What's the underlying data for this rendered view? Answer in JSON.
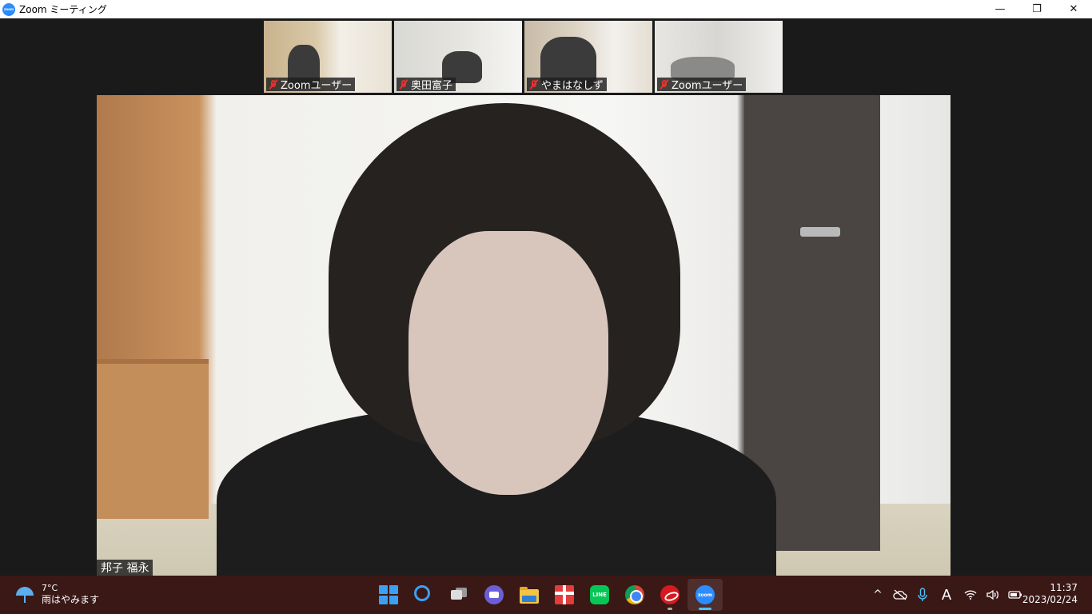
{
  "window": {
    "logo_text": "zoom",
    "title": "Zoom ミーティング",
    "minimize_glyph": "—",
    "maximize_glyph": "❐",
    "close_glyph": "✕"
  },
  "participants": [
    {
      "name": "Zoomユーザー",
      "muted": true
    },
    {
      "name": "奥田富子",
      "muted": true
    },
    {
      "name": "やまはなしず",
      "muted": true
    },
    {
      "name": "Zoomユーザー",
      "muted": true
    }
  ],
  "speaker": {
    "name": "邦子 福永"
  },
  "taskbar": {
    "weather": {
      "temperature": "7°C",
      "description": "雨はやみます",
      "icon": "umbrella-rain-icon"
    },
    "apps": [
      {
        "name": "start",
        "icon": "windows-start-icon"
      },
      {
        "name": "search",
        "icon": "search-icon"
      },
      {
        "name": "task-view",
        "icon": "task-view-icon"
      },
      {
        "name": "chat",
        "icon": "teams-chat-icon"
      },
      {
        "name": "file-explorer",
        "icon": "folder-icon"
      },
      {
        "name": "gift",
        "icon": "gift-icon"
      },
      {
        "name": "line",
        "icon": "line-icon",
        "label": "LINE"
      },
      {
        "name": "chrome",
        "icon": "chrome-icon"
      },
      {
        "name": "trend-micro",
        "icon": "trend-micro-icon"
      },
      {
        "name": "zoom",
        "icon": "zoom-icon",
        "label": "zoom",
        "active": true
      }
    ],
    "tray": {
      "chevron": "^",
      "ime": "A",
      "wifi": "wifi-icon",
      "volume": "volume-icon",
      "battery": "battery-icon"
    },
    "clock": {
      "time": "11:37",
      "date": "2023/02/24"
    }
  },
  "colors": {
    "zoom_blue": "#2d8cff",
    "mute_red": "#e5322d",
    "taskbar_bg": "#3a1816",
    "meeting_bg": "#1a1a1a"
  }
}
